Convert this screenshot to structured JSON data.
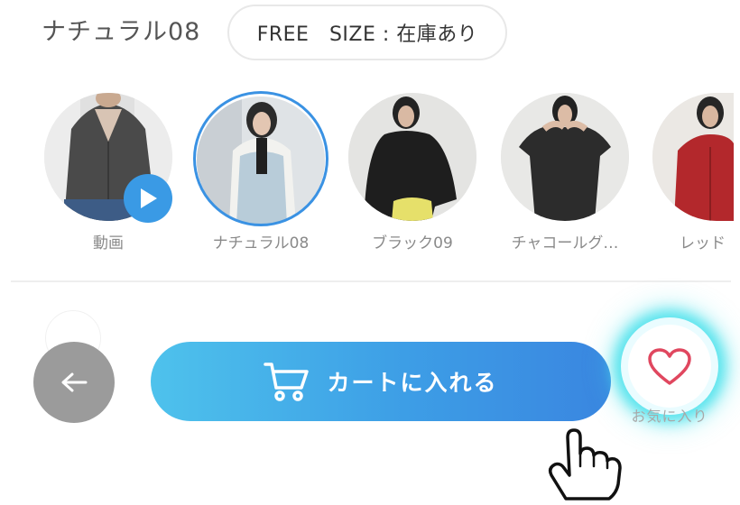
{
  "selection": {
    "color_name": "ナチュラル08",
    "size_status": "FREE　SIZE : 在庫あり"
  },
  "swatches": [
    {
      "label": "動画",
      "has_play": true
    },
    {
      "label": "ナチュラル08",
      "selected": true
    },
    {
      "label": "ブラック09"
    },
    {
      "label": "チャコールグ…"
    },
    {
      "label": "レッド"
    }
  ],
  "actions": {
    "back_icon": "arrow-left-icon",
    "cart_label": "カートに入れる",
    "cart_icon": "cart-icon",
    "favorite_label": "お気に入り",
    "favorite_icon": "heart-icon"
  },
  "colors": {
    "accent_blue": "#3a92e3",
    "cart_gradient_start": "#4ec2ec",
    "cart_gradient_end": "#3a86e0",
    "favorite_heart": "#e0475f",
    "favorite_glow": "#46e1eb",
    "back_button": "#9b9b9b"
  }
}
